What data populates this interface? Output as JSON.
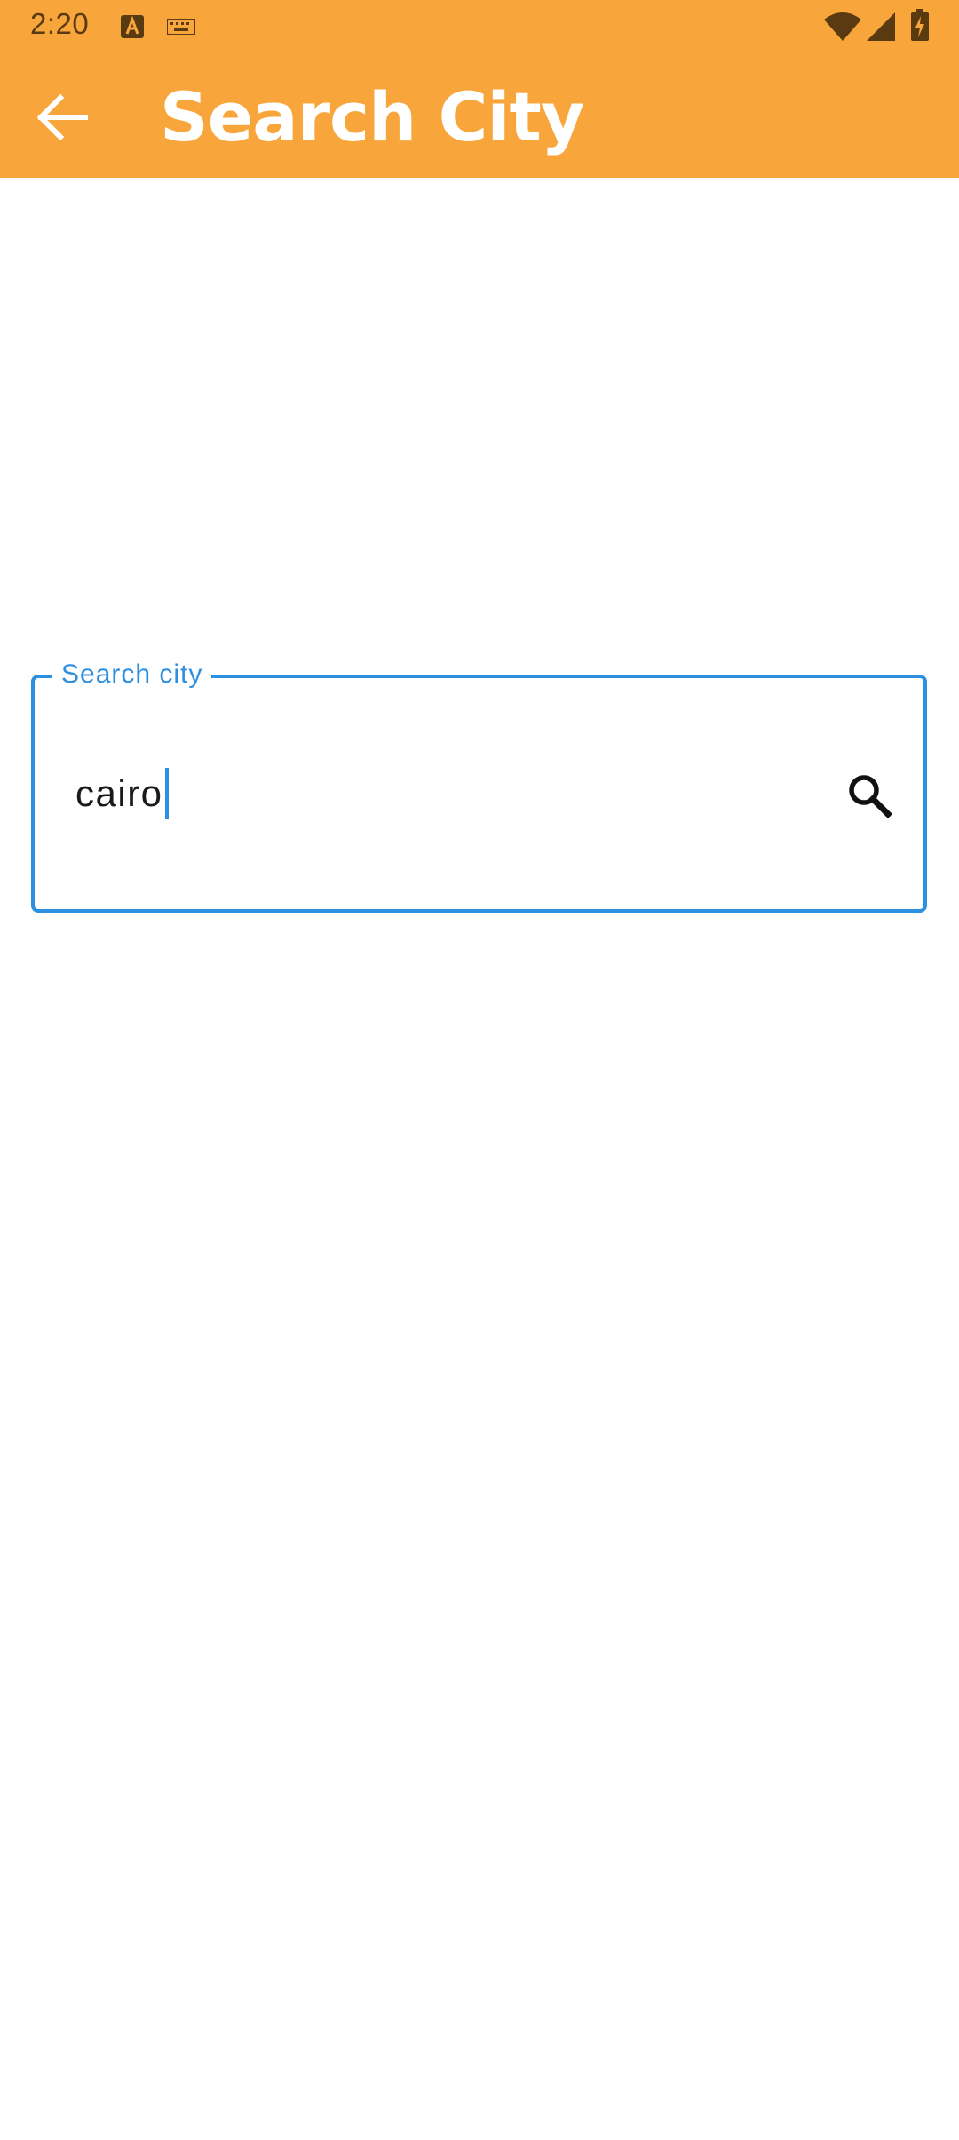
{
  "status_bar": {
    "time": "2:20",
    "icons": [
      "a-notification-icon",
      "keyboard-icon",
      "wifi-icon",
      "cell-signal-icon",
      "battery-charging-icon"
    ]
  },
  "app_bar": {
    "title": "Search City",
    "back_icon": "arrow-back-icon",
    "background_color": "#F8A63C"
  },
  "search": {
    "label": "Search city",
    "value": "cairo",
    "icon": "search-icon",
    "accent_color": "#2D8FE0"
  }
}
